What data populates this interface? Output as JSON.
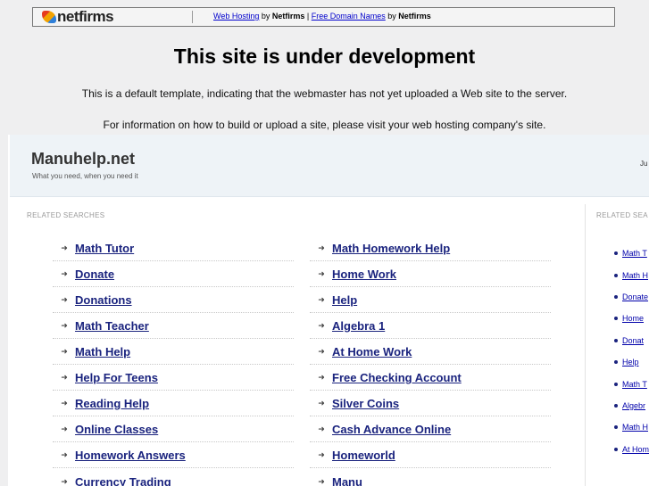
{
  "topbar": {
    "logo_text": "netfirms",
    "link1": "Web Hosting",
    "by1": " by ",
    "brand1": "Netfirms",
    "sep": " | ",
    "link2": "Free Domain Names",
    "by2": " by ",
    "brand2": "Netfirms"
  },
  "main": {
    "title": "This site is under development",
    "line1": "This is a default template, indicating that the webmaster has not yet uploaded a Web site to the server.",
    "line2": "For information on how to build or upload a site, please visit your web hosting company's site."
  },
  "panel": {
    "site_name": "Manuhelp.net",
    "tagline": "What you need, when you need it",
    "header_right": "Ju",
    "related_label": "RELATED SEARCHES",
    "related_label_right": "RELATED SEA",
    "column1": [
      "Math Tutor",
      "Donate",
      "Donations",
      "Math Teacher",
      "Math Help",
      "Help For Teens",
      "Reading Help",
      "Online Classes",
      "Homework Answers",
      "Currency Trading"
    ],
    "column2": [
      "Math Homework Help",
      "Home Work",
      "Help",
      "Algebra 1",
      "At Home Work",
      "Free Checking Account",
      "Silver Coins",
      "Cash Advance Online",
      "Homeworld",
      "Manu"
    ],
    "side_links": [
      "Math T",
      "Math H",
      "Donate",
      "Home",
      "Donat",
      "Help",
      "Math T",
      "Algebr",
      "Math H",
      "At Hom"
    ]
  }
}
